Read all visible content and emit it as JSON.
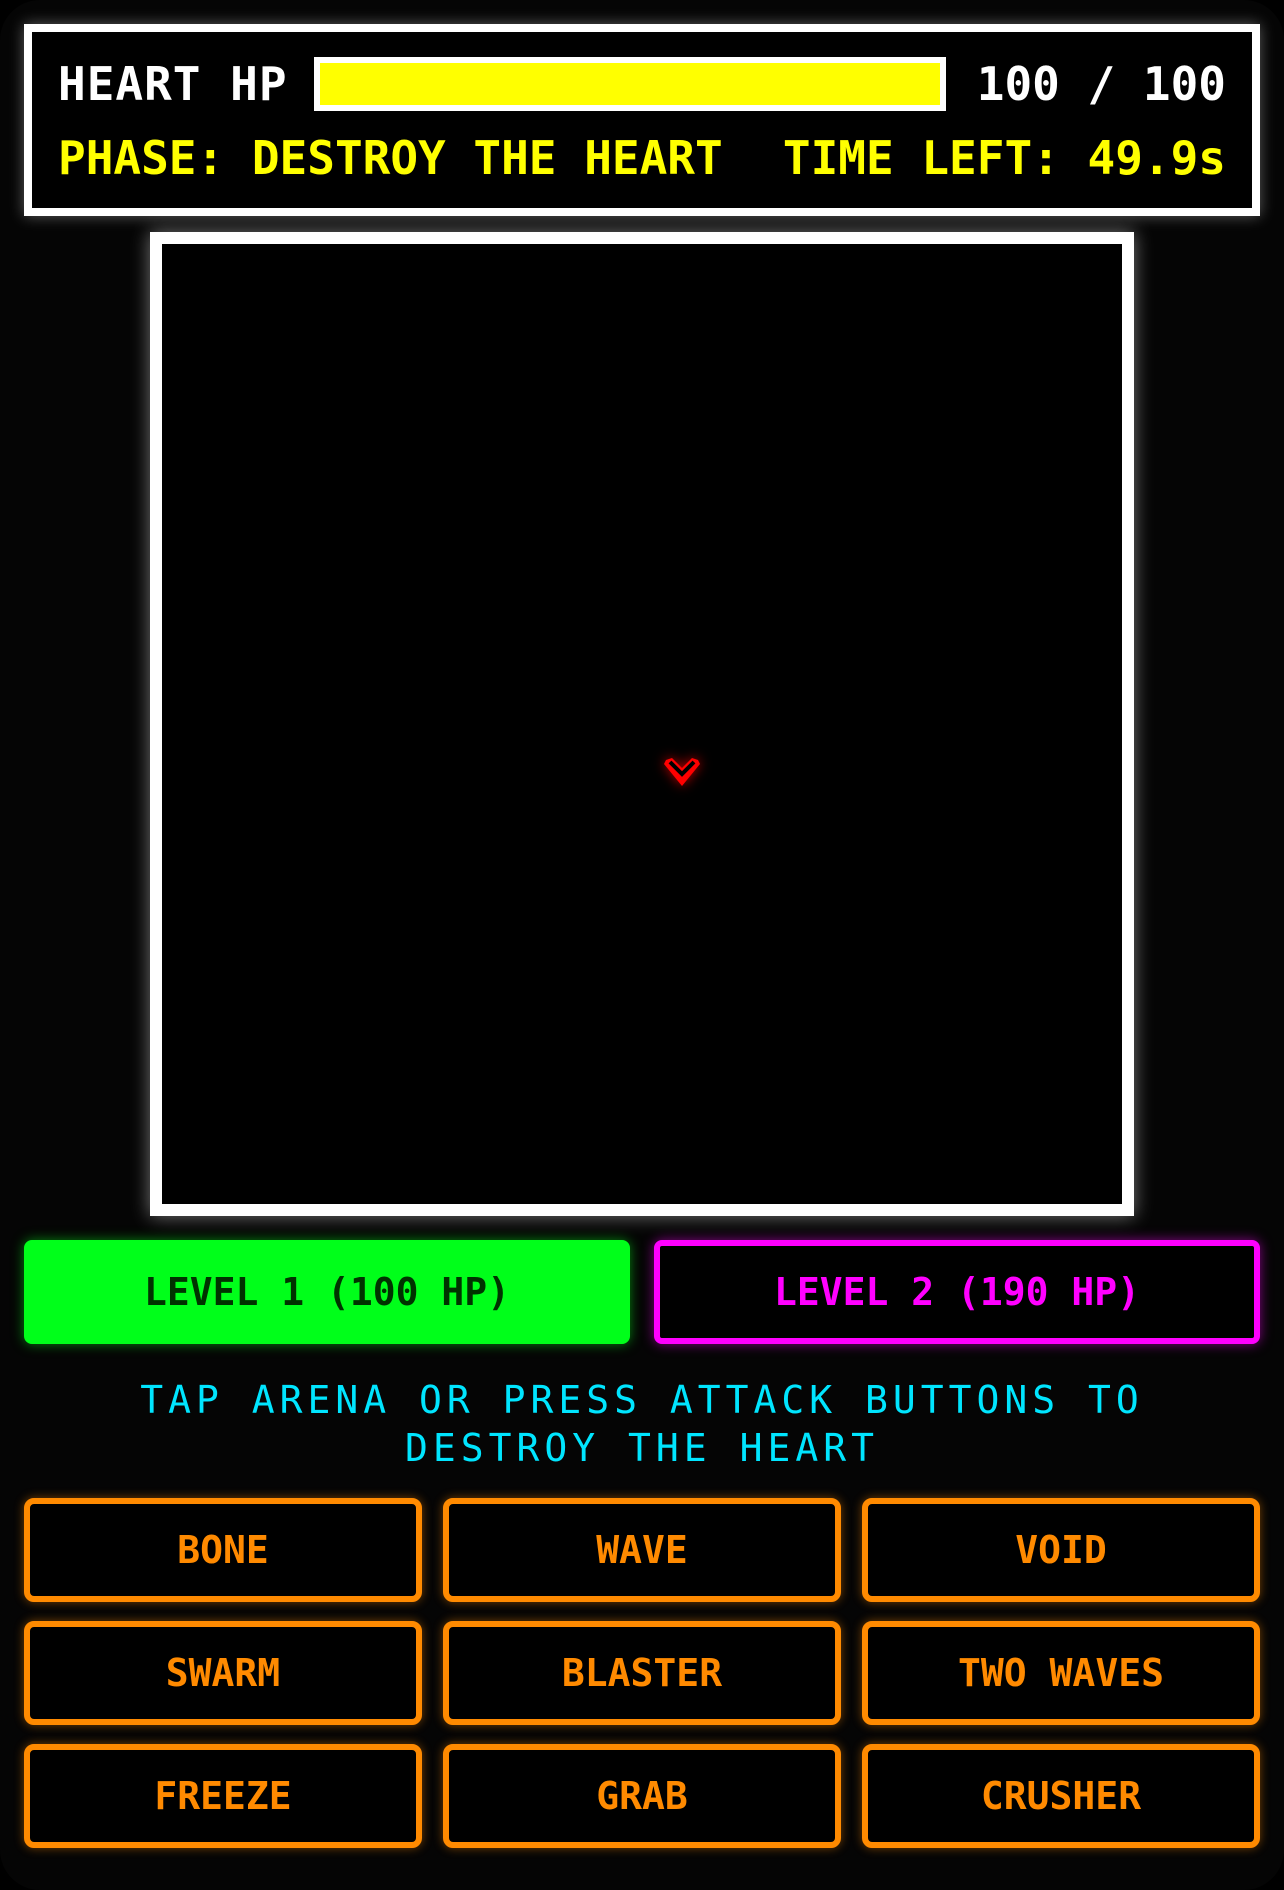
{
  "hud": {
    "hp_label": "HEART HP",
    "hp_current": 100,
    "hp_max": 100,
    "hp_text": "100 / 100",
    "hp_bar_color": "#ffff00",
    "phase_text": "PHASE: DESTROY THE HEART",
    "time_text": "TIME LEFT: 49.9s"
  },
  "arena": {
    "heart_icon": "heart-icon",
    "heart_color": "#ff0000"
  },
  "levels": [
    {
      "label": "LEVEL 1 (100 HP)",
      "color": "#00ff1a",
      "selected": true
    },
    {
      "label": "LEVEL 2 (190 HP)",
      "color": "#ff00ff",
      "selected": false
    }
  ],
  "instructions": "TAP ARENA OR PRESS ATTACK BUTTONS TO DESTROY THE HEART",
  "attacks": [
    {
      "label": "BONE"
    },
    {
      "label": "WAVE"
    },
    {
      "label": "VOID"
    },
    {
      "label": "SWARM"
    },
    {
      "label": "BLASTER"
    },
    {
      "label": "TWO WAVES"
    },
    {
      "label": "FREEZE"
    },
    {
      "label": "GRAB"
    },
    {
      "label": "CRUSHER"
    }
  ],
  "colors": {
    "attack": "#ff8a00",
    "instructions": "#00e5ff",
    "border": "#ffffff"
  }
}
